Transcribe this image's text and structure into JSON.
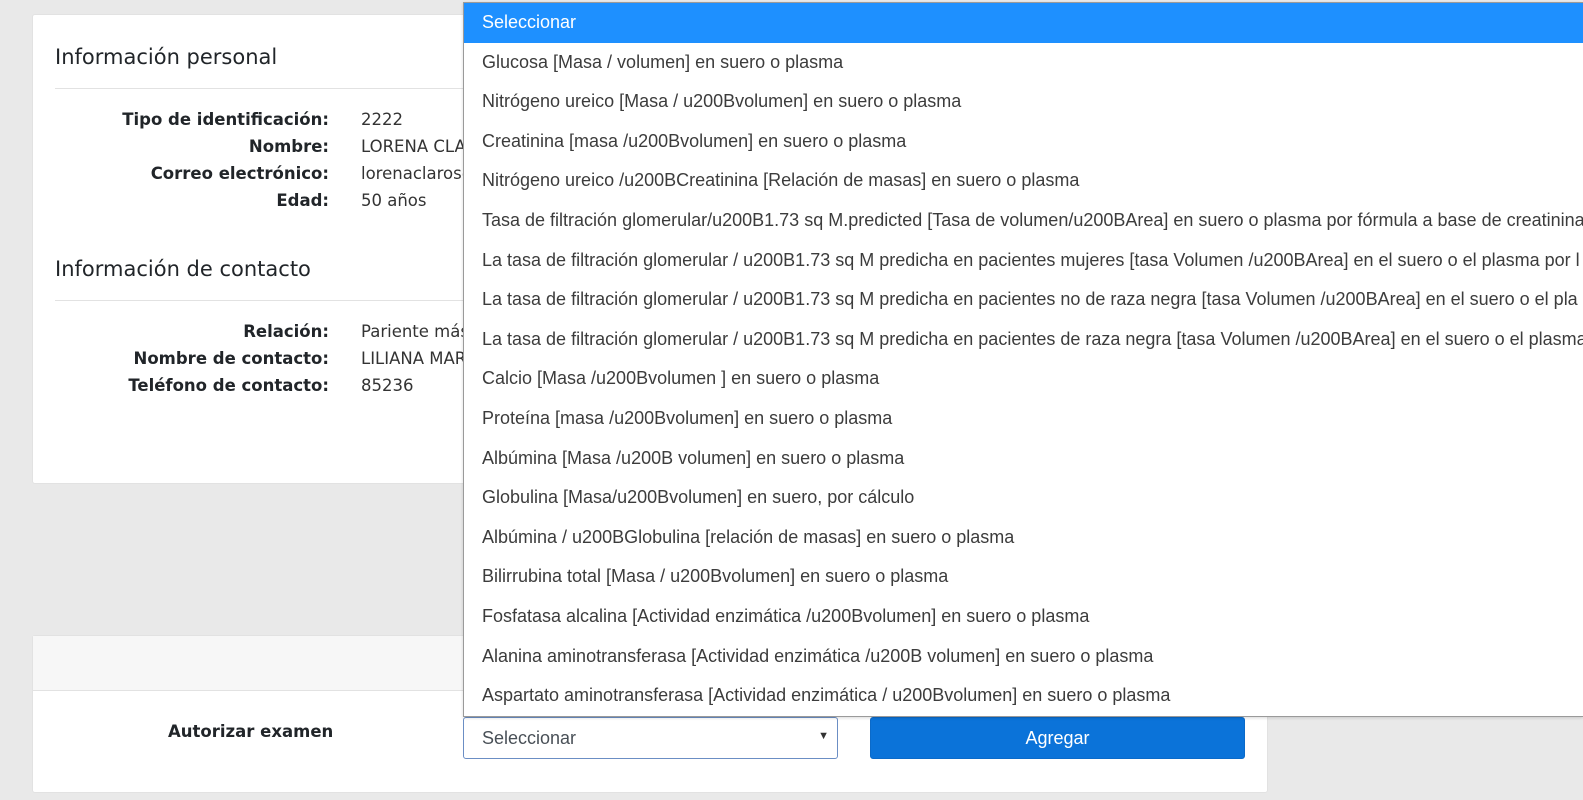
{
  "personal": {
    "title": "Información personal",
    "fields": [
      {
        "label": "Tipo de identificación:",
        "value": "2222"
      },
      {
        "label": "Nombre:",
        "value": "LORENA CLA"
      },
      {
        "label": "Correo electrónico:",
        "value": "lorenaclaros@"
      },
      {
        "label": "Edad:",
        "value": "50 años"
      }
    ]
  },
  "contact": {
    "title": "Información de contacto",
    "fields": [
      {
        "label": "Relación:",
        "value": "Pariente más"
      },
      {
        "label": "Nombre de contacto:",
        "value": "LILIANA MAR"
      },
      {
        "label": "Teléfono de contacto:",
        "value": "85236"
      }
    ]
  },
  "exam": {
    "label": "Autorizar examen",
    "select_value": "Seleccionar",
    "add_button": "Agregar"
  },
  "dropdown": {
    "selected_index": 0,
    "options": [
      "Seleccionar",
      "Glucosa [Masa / volumen] en suero o plasma",
      "Nitrógeno ureico [Masa / u200Bvolumen] en suero o plasma",
      "Creatinina [masa /u200Bvolumen] en suero o plasma",
      "Nitrógeno ureico /u200BCreatinina [Relación de masas] en suero o plasma",
      "Tasa de filtración glomerular/u200B1.73 sq M.predicted [Tasa de volumen/u200BArea] en suero o plasma por fórmula a base de creatinina",
      "La tasa de filtración glomerular / u200B1.73 sq M predicha en pacientes mujeres [tasa Volumen /u200BArea] en el suero o el plasma por l",
      "La tasa de filtración glomerular / u200B1.73 sq M predicha en pacientes no de raza negra [tasa Volumen /u200BArea] en el suero o el pla",
      "La tasa de filtración glomerular / u200B1.73 sq M predicha en pacientes de raza negra [tasa Volumen /u200BArea] en el suero o el plasma",
      "Calcio [Masa /u200Bvolumen ] en suero o plasma",
      "Proteína [masa /u200Bvolumen] en suero o plasma",
      "Albúmina [Masa /u200B volumen] en suero o plasma",
      "Globulina [Masa/u200Bvolumen] en suero, por cálculo",
      "Albúmina / u200BGlobulina [relación de masas] en suero o plasma",
      "Bilirrubina total [Masa / u200Bvolumen] en suero o plasma",
      "Fosfatasa alcalina [Actividad enzimática /u200Bvolumen] en suero o plasma",
      "Alanina aminotransferasa [Actividad enzimática /u200B volumen] en suero o plasma",
      "Aspartato aminotransferasa [Actividad enzimática / u200Bvolumen] en suero o plasma"
    ]
  }
}
